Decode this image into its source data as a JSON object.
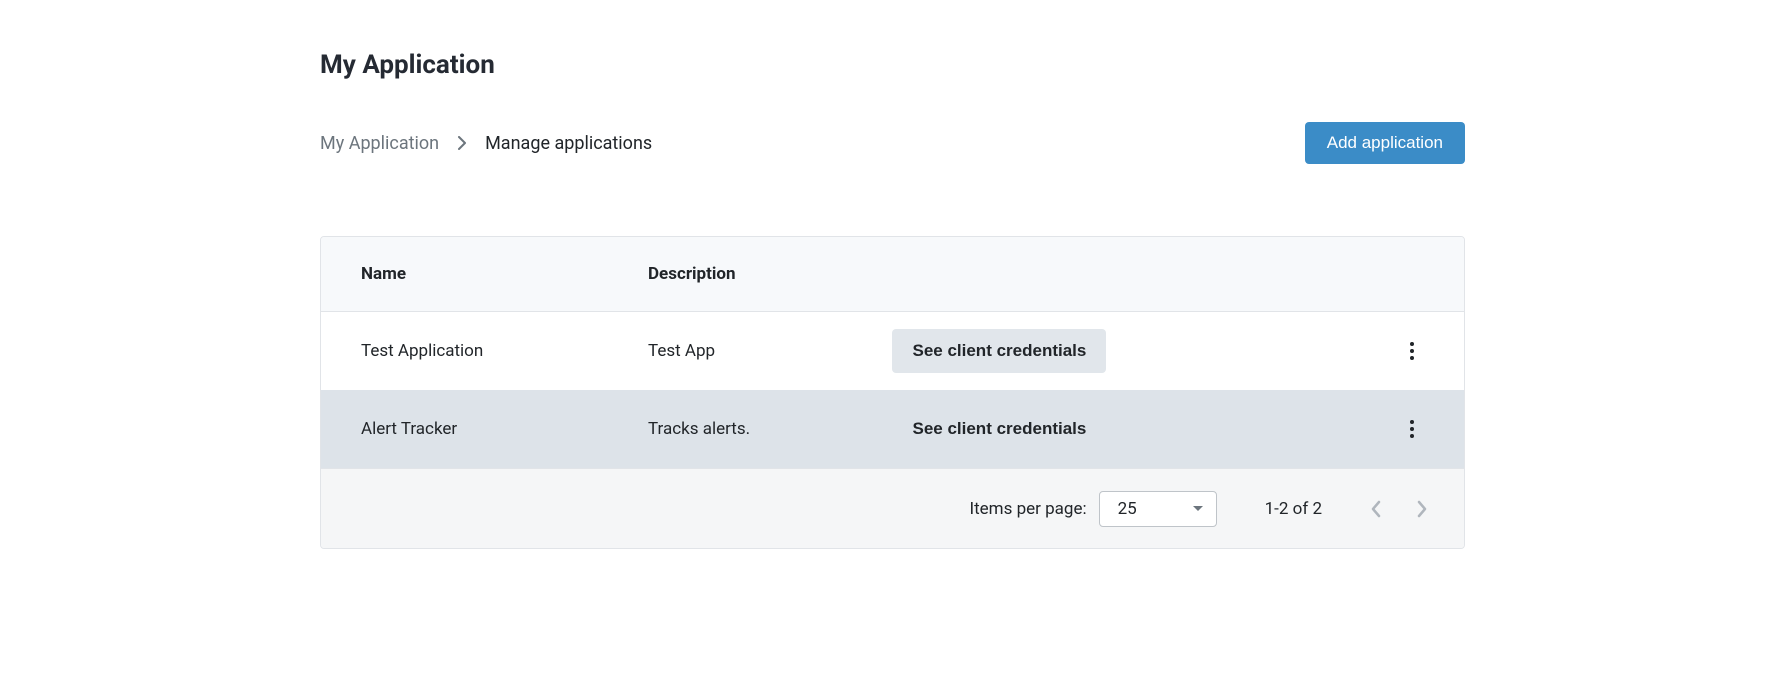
{
  "page": {
    "title": "My Application"
  },
  "breadcrumb": {
    "parent": "My Application",
    "current": "Manage applications"
  },
  "actions": {
    "add_application": "Add application"
  },
  "table": {
    "headers": {
      "name": "Name",
      "description": "Description"
    },
    "credentials_label": "See client credentials",
    "rows": [
      {
        "name": "Test Application",
        "description": "Test App"
      },
      {
        "name": "Alert Tracker",
        "description": "Tracks alerts."
      }
    ]
  },
  "pagination": {
    "items_per_page_label": "Items per page:",
    "items_per_page_value": "25",
    "range": "1-2 of 2"
  }
}
